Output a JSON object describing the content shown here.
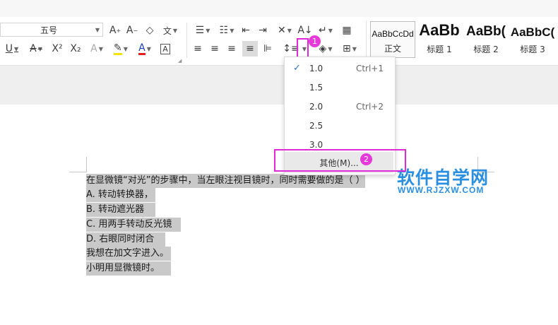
{
  "font_size_combo": "五号",
  "styles": [
    {
      "preview": "AaBbCcDd",
      "name": "正文"
    },
    {
      "preview": "AaBb",
      "name": "标题 1"
    },
    {
      "preview": "AaBb(",
      "name": "标题 2"
    },
    {
      "preview": "AaBbC(",
      "name": "标题 3"
    }
  ],
  "line_spacing_menu": {
    "items": [
      {
        "value": "1.0",
        "shortcut": "Ctrl+1",
        "checked": true
      },
      {
        "value": "1.5",
        "shortcut": ""
      },
      {
        "value": "2.0",
        "shortcut": "Ctrl+2"
      },
      {
        "value": "2.5",
        "shortcut": ""
      },
      {
        "value": "3.0",
        "shortcut": ""
      }
    ],
    "other": "其他(M)..."
  },
  "badges": {
    "first": "1",
    "second": "2"
  },
  "document": {
    "lines": [
      "在显微镜“对光”的步骤中，当左眼注视目镜时，同时需要做的是（   ）",
      "A.  转动转换器，",
      "B.  转动遮光器",
      "C.  用两手转动反光镜",
      "D.  右眼同时闭合",
      "我想在加文字进入。",
      "小明用显微镜时。"
    ]
  },
  "watermark": {
    "title": "软件自学网",
    "url": "WWW.RJZXW.COM"
  },
  "colors": {
    "highlight": "#e02ad8",
    "selection": "#c9c9c9",
    "watermark": "#2a8fe0",
    "check": "#2a6fd6"
  }
}
